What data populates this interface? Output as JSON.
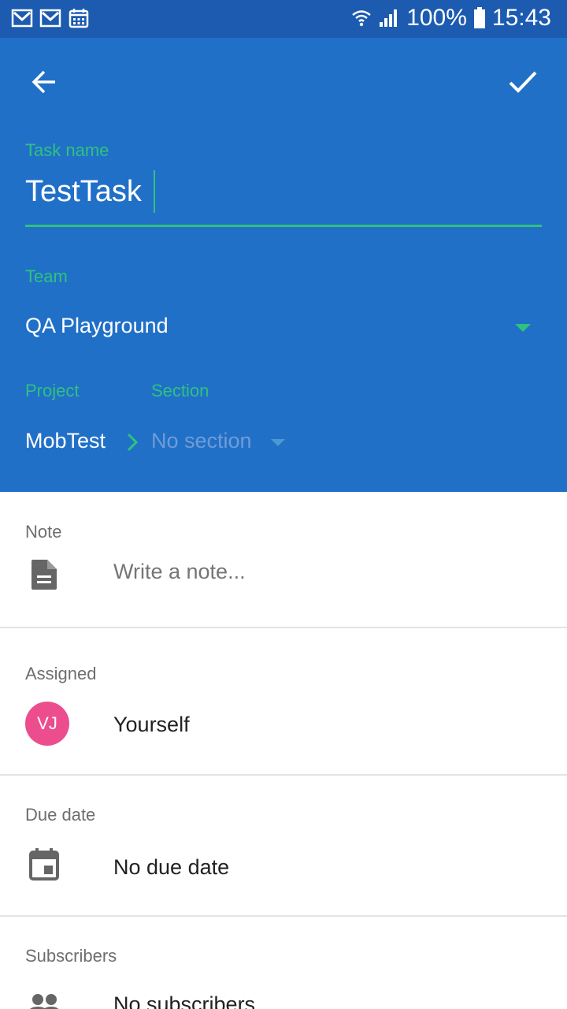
{
  "status_bar": {
    "notification_icons": [
      "gmail-icon",
      "gmail-icon",
      "calendar-icon"
    ],
    "battery": "100%",
    "time": "15:43"
  },
  "header": {
    "back_icon": "arrow-back-icon",
    "confirm_icon": "check-icon",
    "task_name_label": "Task name",
    "task_name_value": "TestTask",
    "team_label": "Team",
    "team_value": "QA Playground",
    "project_label": "Project",
    "project_value": "MobTest",
    "section_label": "Section",
    "section_value": "No section"
  },
  "note": {
    "label": "Note",
    "placeholder": "Write a note...",
    "icon": "document-icon"
  },
  "assigned": {
    "label": "Assigned",
    "avatar_initials": "VJ",
    "value": "Yourself"
  },
  "due_date": {
    "label": "Due date",
    "value": "No due date",
    "icon": "calendar-icon"
  },
  "subscribers": {
    "label": "Subscribers",
    "value": "No subscribers",
    "icon": "people-icon"
  },
  "colors": {
    "header_bg": "#2170c8",
    "status_bg": "#1c5bb0",
    "accent_green": "#2ec27e",
    "avatar_pink": "#ec4d8e"
  }
}
